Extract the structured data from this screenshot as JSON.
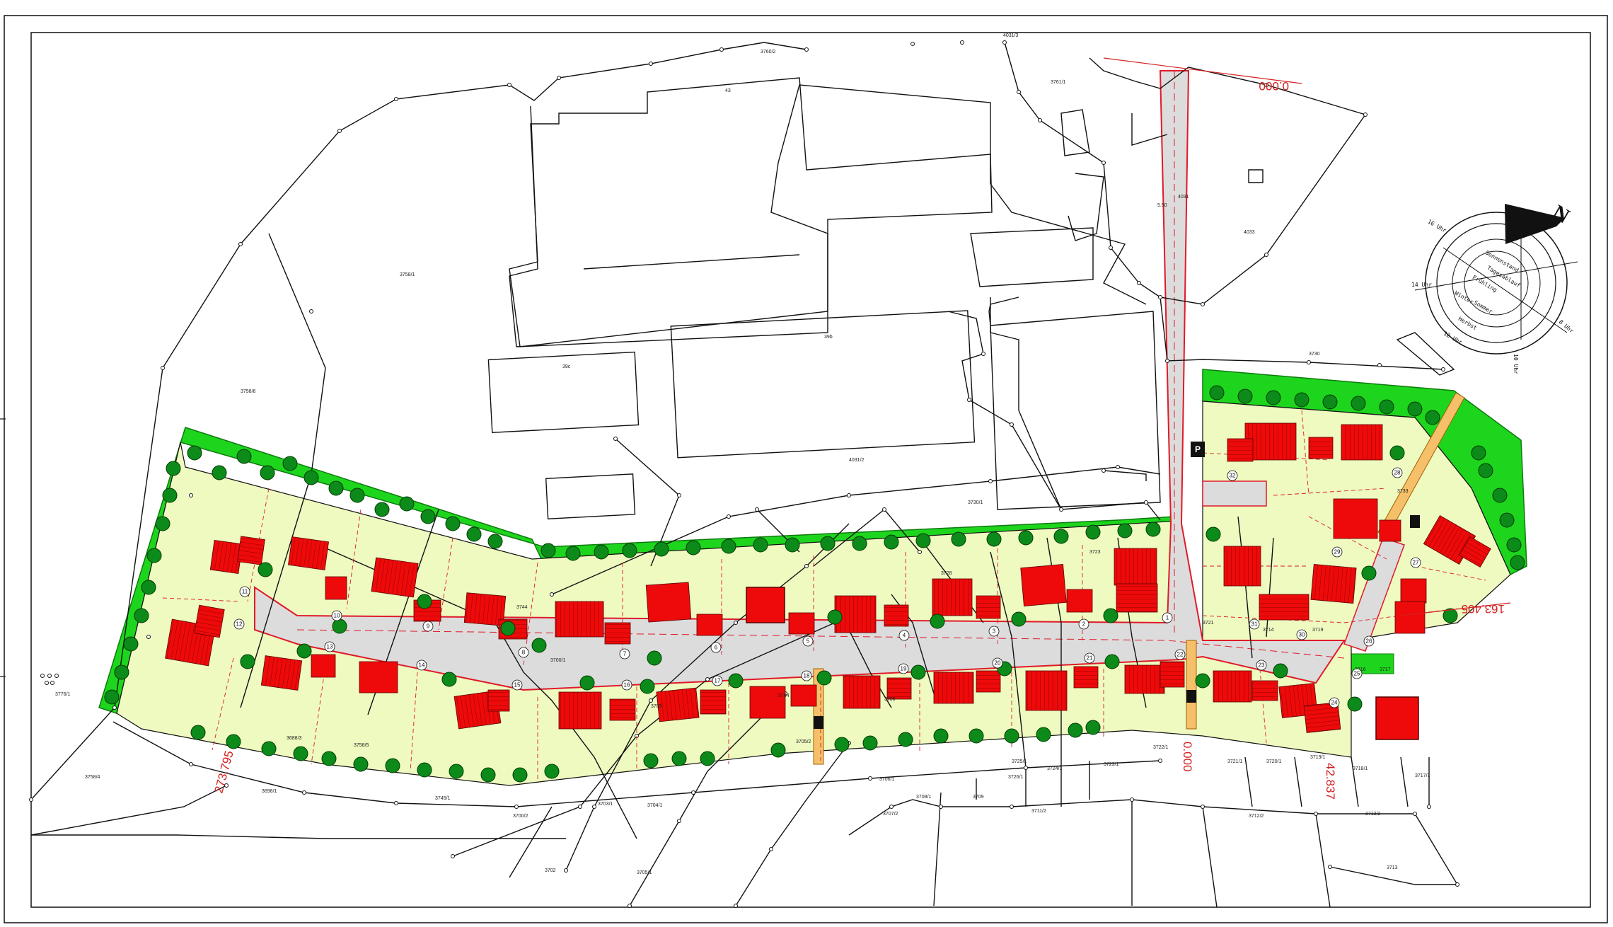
{
  "colors": {
    "green_belt": "#1ed51e",
    "plot_fill": "#eefac0",
    "house": "#ee0a0a",
    "road": "#dcdcdc",
    "road_edge": "#e01a2a",
    "tree": "#0c8a1a",
    "path": "#f6c06a",
    "line": "#111111",
    "dimension": "#d42020"
  },
  "dimensions": {
    "d1": "0.000",
    "d2": "163.405",
    "d3": "0.000",
    "d4": "42.837",
    "d5": "273.795"
  },
  "parcels": [
    "3760/2",
    "43",
    "4031/3",
    "3761/1",
    "3758/1",
    "4031",
    "4033",
    "39b",
    "39c",
    "3758/6",
    "4031/2",
    "3730",
    "3730/1",
    "3733",
    "3744",
    "3728",
    "3723",
    "3721",
    "3719",
    "3716",
    "3717",
    "3700/1",
    "3703",
    "3704",
    "3705/2",
    "3706",
    "3714",
    "3688/3",
    "3758/5",
    "3700/2",
    "3702",
    "3705/1",
    "3703/1",
    "3704/1",
    "3745/1",
    "3698/1",
    "3758/4",
    "3776/1",
    "3722/1",
    "3721/1",
    "3720/1",
    "3719/1",
    "3718/1",
    "3717/1",
    "3712/2",
    "3713/2",
    "3713",
    "3711/2",
    "3707/2",
    "3706/1",
    "3708/1",
    "3725/1",
    "3724/1",
    "3723/1",
    "3726/1",
    "3709"
  ],
  "lots": [
    "1",
    "2",
    "3",
    "4",
    "5",
    "6",
    "7",
    "8",
    "9",
    "10",
    "11",
    "12",
    "13",
    "14",
    "15",
    "16",
    "17",
    "18",
    "19",
    "20",
    "21",
    "22",
    "23",
    "24",
    "25",
    "26",
    "27",
    "28",
    "29",
    "30",
    "31",
    "32"
  ],
  "road_width": "5.50",
  "parking_sign": "P",
  "compass": {
    "north": "N",
    "title1": "Sonnenstand",
    "title2": "Frühling",
    "season1": "Sommer",
    "season2": "Herbst",
    "season3": "Winter",
    "line2": "Tagesablauf",
    "h16": "16 Uhr",
    "h14": "14 Uhr",
    "h12": "12 Uhr",
    "h10": "10 Uhr",
    "h8": "8 Uhr"
  }
}
